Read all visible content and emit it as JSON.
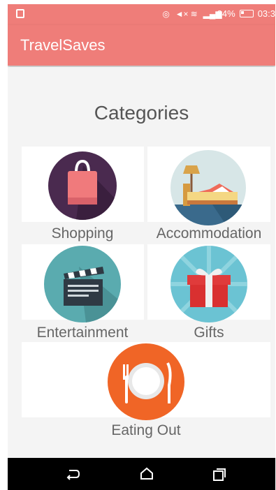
{
  "status_bar": {
    "battery": "24%",
    "time": "03:3"
  },
  "app_bar": {
    "title": "TravelSaves"
  },
  "page_title": "Categories",
  "categories": [
    {
      "label": "Shopping",
      "icon": "shopping-bag-icon",
      "color": "#4a2a4f"
    },
    {
      "label": "Accommodation",
      "icon": "bed-icon",
      "color": "#d7e6e7"
    },
    {
      "label": "Entertainment",
      "icon": "clapperboard-icon",
      "color": "#5aabaf"
    },
    {
      "label": "Gifts",
      "icon": "gift-icon",
      "color": "#6bc3d3"
    },
    {
      "label": "Eating Out",
      "icon": "plate-cutlery-icon",
      "color": "#f06526"
    }
  ],
  "nav_bar": {
    "back": "back-icon",
    "home": "home-icon",
    "recents": "recents-icon"
  },
  "colors": {
    "accent": "#ef7d79"
  }
}
